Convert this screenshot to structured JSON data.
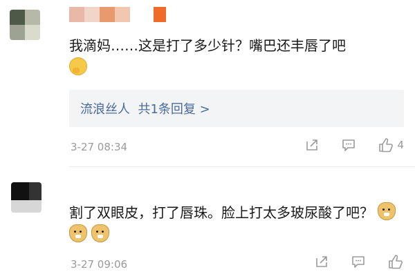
{
  "comments": [
    {
      "text": "我滴妈……这是打了多少针？嘴巴还丰唇了吧",
      "emojis": [
        "thinking-emoji"
      ],
      "reply": {
        "user": "流浪丝人",
        "summary": "共1条回复 >"
      },
      "time": "3-27 08:34",
      "likes": "4"
    },
    {
      "text": "割了双眼皮，打了唇珠。脸上打太多玻尿酸了吧？",
      "emojis": [
        "doge-emoji",
        "doge-emoji",
        "doge-emoji"
      ],
      "time": "3-27 09:06",
      "likes": ""
    }
  ],
  "colors": {
    "reply_link": "#4a6b9a",
    "meta": "#9a9a9a",
    "reply_bg": "#f3f4f6"
  },
  "icons": [
    "share-icon",
    "comment-icon",
    "like-icon"
  ]
}
